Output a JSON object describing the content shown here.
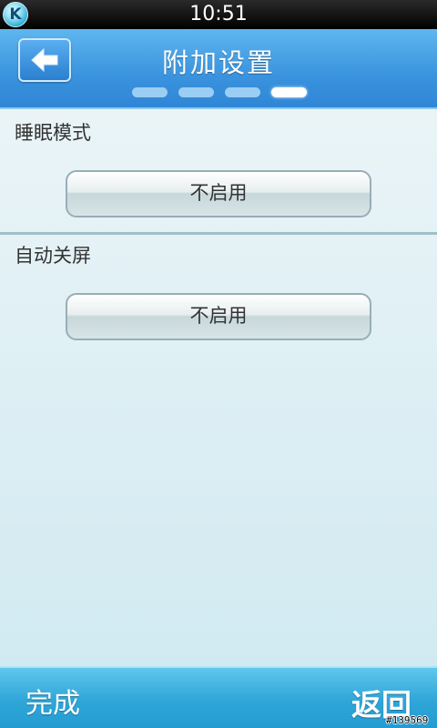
{
  "status_bar": {
    "logo_letter": "K",
    "time": "10:51"
  },
  "header": {
    "back_icon": "arrow-left-icon",
    "title": "附加设置",
    "page_indicator": {
      "total": 4,
      "active_index": 3
    }
  },
  "sections": [
    {
      "label": "睡眠模式",
      "value": "不启用"
    },
    {
      "label": "自动关屏",
      "value": "不启用"
    }
  ],
  "bottom_bar": {
    "done_label": "完成",
    "return_label": "返回"
  },
  "watermark": "#139569",
  "colors": {
    "header_blue": "#3a93de",
    "bottom_bar_blue": "#2fa6d8",
    "content_bg": "#e3f0f4"
  }
}
